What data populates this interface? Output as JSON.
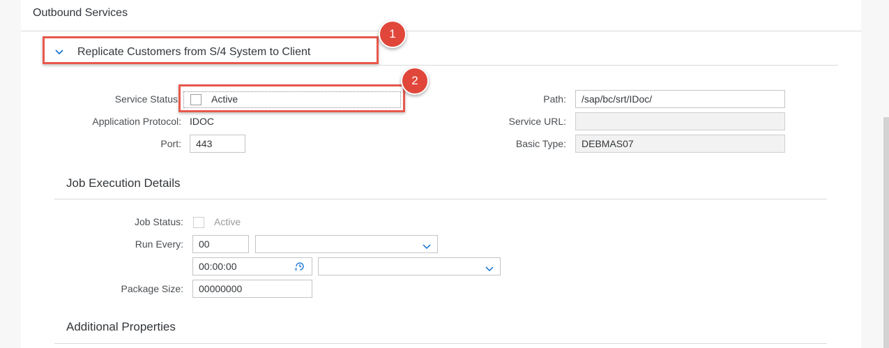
{
  "header": {
    "title": "Outbound Services"
  },
  "service_panel": {
    "title": "Replicate Customers from S/4 System to Client",
    "left": {
      "service_status_label": "Service Status",
      "service_status_option": "Active",
      "app_protocol_label": "Application Protocol:",
      "app_protocol_value": "IDOC",
      "port_label": "Port:",
      "port_value": "443"
    },
    "right": {
      "path_label": "Path:",
      "path_value": "/sap/bc/srt/IDoc/",
      "service_url_label": "Service URL:",
      "service_url_value": "",
      "basic_type_label": "Basic Type:",
      "basic_type_value": "DEBMAS07"
    }
  },
  "job_section": {
    "title": "Job Execution Details",
    "job_status_label": "Job Status:",
    "job_status_option": "Active",
    "run_every_label": "Run Every:",
    "run_every_value": "00",
    "run_every_unit": "",
    "time_value": "00:00:00",
    "time_unit": "",
    "package_size_label": "Package Size:",
    "package_size_value": "00000000"
  },
  "additional_section": {
    "title": "Additional Properties"
  },
  "annotations": {
    "badge1": "1",
    "badge2": "2",
    "highlight_color": "#e8584c",
    "badge_color": "#e0473a"
  },
  "icons": {
    "collapse": "chevron-down-icon",
    "dropdown": "chevron-down-icon",
    "time": "clock-icon"
  }
}
